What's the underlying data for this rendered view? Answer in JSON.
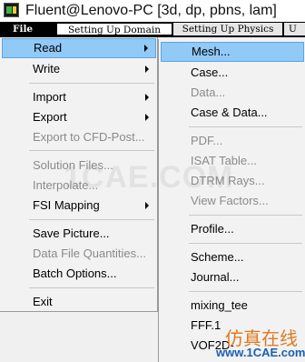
{
  "window": {
    "title": "Fluent@Lenovo-PC  [3d, dp, pbns, lam]",
    "icon": "fluent-app-icon"
  },
  "menubar": {
    "items": [
      {
        "label": "File"
      },
      {
        "label": "Setting Up Domain"
      },
      {
        "label": "Setting Up Physics"
      },
      {
        "label": "U"
      }
    ]
  },
  "file_menu": {
    "items": [
      {
        "label": "Read",
        "submenu": true,
        "enabled": true,
        "highlighted": true
      },
      {
        "label": "Write",
        "submenu": true,
        "enabled": true
      },
      {
        "label": "Import",
        "submenu": true,
        "enabled": true
      },
      {
        "label": "Export",
        "submenu": true,
        "enabled": true
      },
      {
        "label": "Export to CFD-Post...",
        "enabled": false
      },
      {
        "label": "Solution Files...",
        "enabled": false
      },
      {
        "label": "Interpolate...",
        "enabled": false
      },
      {
        "label": "FSI Mapping",
        "submenu": true,
        "enabled": true
      },
      {
        "label": "Save Picture...",
        "enabled": true
      },
      {
        "label": "Data File Quantities...",
        "enabled": false
      },
      {
        "label": "Batch Options...",
        "enabled": true
      },
      {
        "label": "Exit",
        "enabled": true
      }
    ]
  },
  "read_submenu": {
    "items": [
      {
        "label": "Mesh...",
        "enabled": true,
        "highlighted": true
      },
      {
        "label": "Case...",
        "enabled": true
      },
      {
        "label": "Data...",
        "enabled": false
      },
      {
        "label": "Case & Data...",
        "enabled": true
      },
      {
        "label": "PDF...",
        "enabled": false
      },
      {
        "label": "ISAT Table...",
        "enabled": false
      },
      {
        "label": "DTRM Rays...",
        "enabled": false
      },
      {
        "label": "View Factors...",
        "enabled": false
      },
      {
        "label": "Profile...",
        "enabled": true
      },
      {
        "label": "Scheme...",
        "enabled": true
      },
      {
        "label": "Journal...",
        "enabled": true
      },
      {
        "label": "mixing_tee",
        "enabled": true
      },
      {
        "label": "FFF.1",
        "enabled": true
      },
      {
        "label": "VOF2D-",
        "enabled": true
      }
    ]
  },
  "watermark": {
    "center": "1CAE.COM",
    "chinese": "仿真在线",
    "url": "www.1CAE.com"
  },
  "colors": {
    "highlight": "#91c9f7",
    "disabled_text": "#8a8a8a",
    "menubar_bg": "#000000"
  }
}
